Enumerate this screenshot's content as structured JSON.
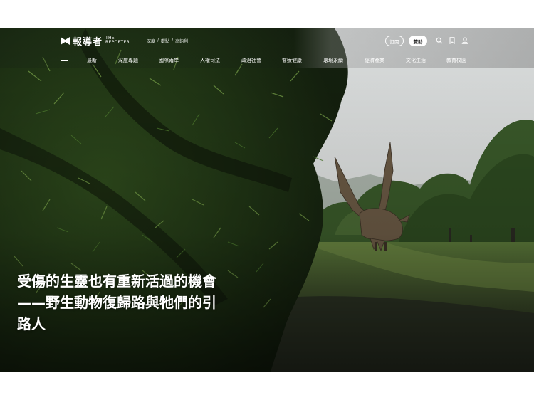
{
  "logo": {
    "chinese": "報導者",
    "english_line1": "THE",
    "english_line2": "REPORTER"
  },
  "breadcrumb": [
    "深度",
    "觀點",
    "高鈞利"
  ],
  "header_buttons": {
    "subscribe": "訂閱",
    "donate": "贊助"
  },
  "header_icons": [
    "search-icon",
    "bookmark-icon",
    "user-icon"
  ],
  "nav": {
    "items": [
      "最新",
      "深度專題",
      "國際兩岸",
      "人權司法",
      "政治社會",
      "醫療健康",
      "環境永續",
      "經濟產業",
      "文化生活",
      "教育校園"
    ]
  },
  "article": {
    "title_lines": [
      "受傷的生靈也有重新活過的機會",
      "——野生動物復歸路與牠們的引",
      "路人"
    ]
  },
  "colors": {
    "accent": "#ffffff",
    "header_overlay": "#8c8c8c"
  }
}
